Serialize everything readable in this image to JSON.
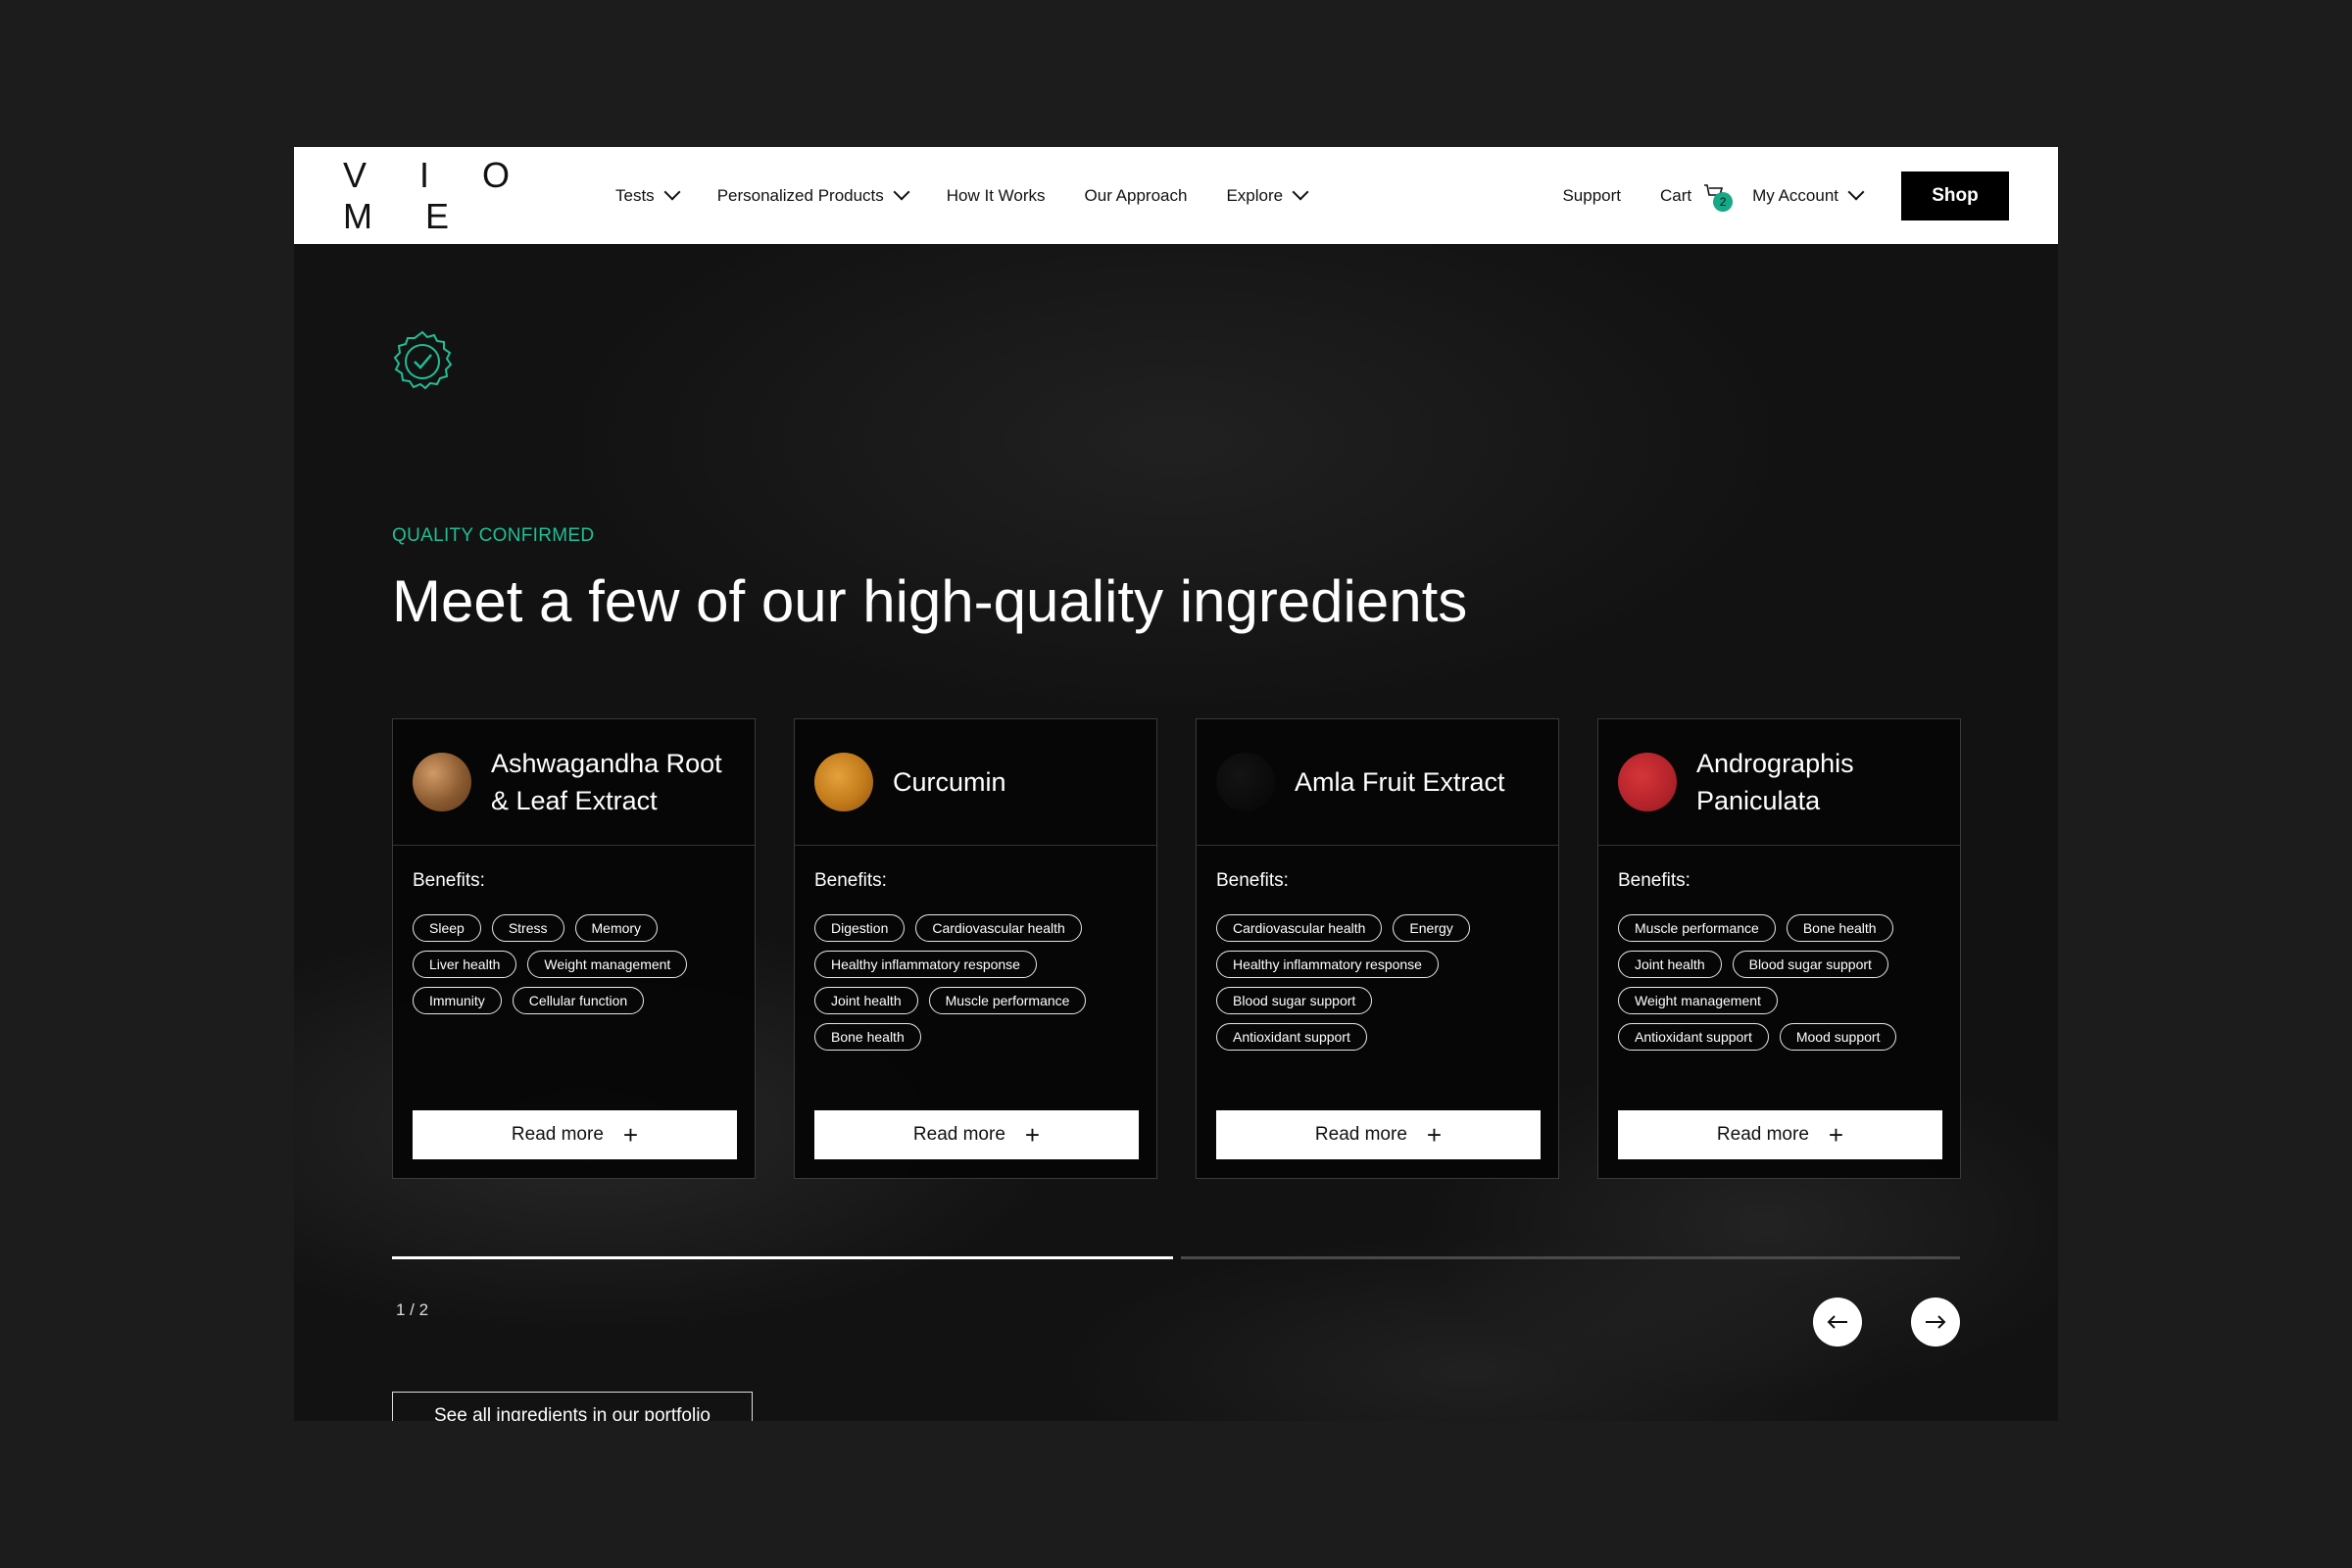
{
  "header": {
    "logo": "V I O M E",
    "nav": [
      {
        "label": "Tests",
        "dropdown": true
      },
      {
        "label": "Personalized Products",
        "dropdown": true
      },
      {
        "label": "How It Works",
        "dropdown": false
      },
      {
        "label": "Our Approach",
        "dropdown": false
      },
      {
        "label": "Explore",
        "dropdown": true
      }
    ],
    "support_label": "Support",
    "cart_label": "Cart",
    "cart_count": "2",
    "account_label": "My Account",
    "shop_label": "Shop"
  },
  "hero": {
    "eyebrow": "QUALITY CONFIRMED",
    "title": "Meet a few of our high-quality ingredients",
    "badge_icon": "verified-check-badge-icon",
    "accent_color": "#1fbf96"
  },
  "cards": [
    {
      "name": "Ashwagandha Root & Leaf Extract",
      "thumb_color": "#a0683a",
      "benefits_label": "Benefits:",
      "tags": [
        "Sleep",
        "Stress",
        "Memory",
        "Liver health",
        "Weight management",
        "Immunity",
        "Cellular function"
      ],
      "button": "Read more"
    },
    {
      "name": "Curcumin",
      "thumb_color": "#c9801e",
      "benefits_label": "Benefits:",
      "tags": [
        "Digestion",
        "Cardiovascular health",
        "Healthy inflammatory response",
        "Joint health",
        "Muscle performance",
        "Bone health"
      ],
      "button": "Read more"
    },
    {
      "name": "Amla Fruit Extract",
      "thumb_color": "#080808",
      "benefits_label": "Benefits:",
      "tags": [
        "Cardiovascular health",
        "Energy",
        "Healthy inflammatory response",
        "Blood sugar support",
        "Antioxidant support"
      ],
      "button": "Read more"
    },
    {
      "name": "Andrographis Paniculata",
      "thumb_color": "#c0282b",
      "benefits_label": "Benefits:",
      "tags": [
        "Muscle performance",
        "Bone health",
        "Joint health",
        "Blood sugar support",
        "Weight management",
        "Antioxidant support",
        "Mood support"
      ],
      "button": "Read more"
    }
  ],
  "carousel": {
    "counter": "1 / 2",
    "progress": 0.5
  },
  "see_all_label": "See all ingredients in our portfolio"
}
